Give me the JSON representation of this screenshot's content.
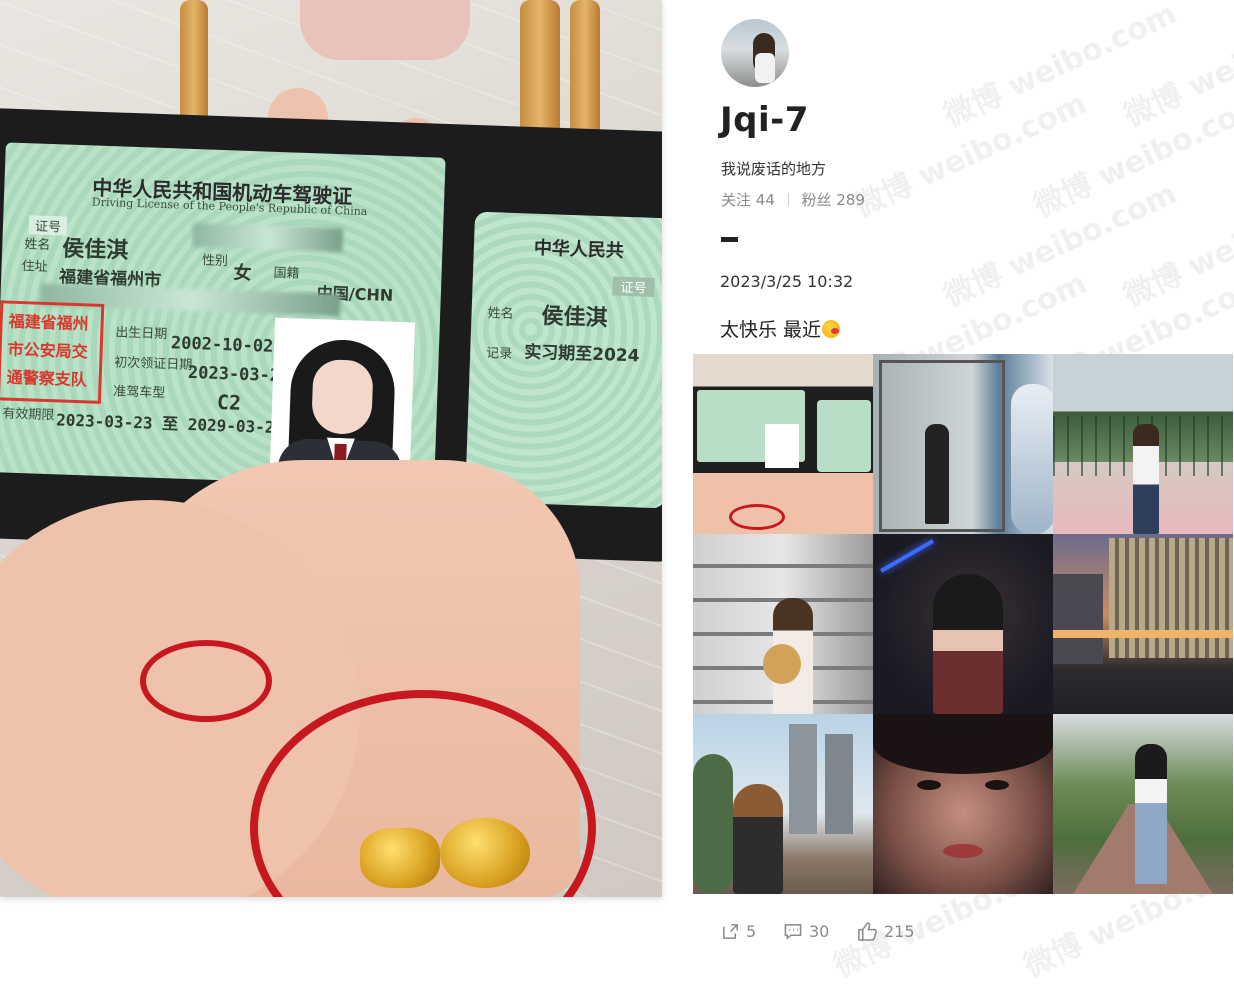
{
  "left_photo": {
    "card_left": {
      "title": "中华人民共和国机动车驾驶证",
      "subtitle": "Driving License of the People's Republic of China",
      "cert_no_label": "证号",
      "name_label": "姓名",
      "name": "侯佳淇",
      "sex_label": "性别",
      "sex": "女",
      "nationality_label": "国籍",
      "nationality": "中国/CHN",
      "address_label": "住址",
      "address": "福建省福州市",
      "birth_label": "出生日期",
      "birth": "2002-10-02",
      "issue_label": "初次领证日期",
      "issue": "2023-03-23",
      "class_label": "准驾车型",
      "class": "C2",
      "valid_label": "有效期限",
      "valid": "2023-03-23 至 2029-03-2",
      "seal": "福建省福州市公安局交通警察支队"
    },
    "card_right": {
      "title": "中华人民共",
      "cert_no_label": "证号",
      "name_label": "姓名",
      "name": "侯佳淇",
      "record_label": "记录",
      "record": "实习期至2024"
    }
  },
  "profile": {
    "avatar_icon": "avatar-photo",
    "username": "Jqi-7",
    "bio": "我说废话的地方",
    "following_label": "关注",
    "following": "44",
    "followers_label": "粉丝",
    "followers": "289"
  },
  "post": {
    "time": "2023/3/25 10:32",
    "text": "太快乐 最近",
    "emoji": "kiss-emoji",
    "images": [
      {
        "name": "grid-image-license"
      },
      {
        "name": "grid-image-store-mirror"
      },
      {
        "name": "grid-image-court"
      },
      {
        "name": "grid-image-warehouse"
      },
      {
        "name": "grid-image-bar"
      },
      {
        "name": "grid-image-city-night"
      },
      {
        "name": "grid-image-towers"
      },
      {
        "name": "grid-image-closeup"
      },
      {
        "name": "grid-image-park-path"
      }
    ],
    "actions": {
      "share": "5",
      "comment": "30",
      "like": "215"
    }
  },
  "watermark": "微博 weibo.com",
  "colors": {
    "accent_red": "#c8181f",
    "text_primary": "#222222",
    "text_muted": "#8a8a8a"
  }
}
